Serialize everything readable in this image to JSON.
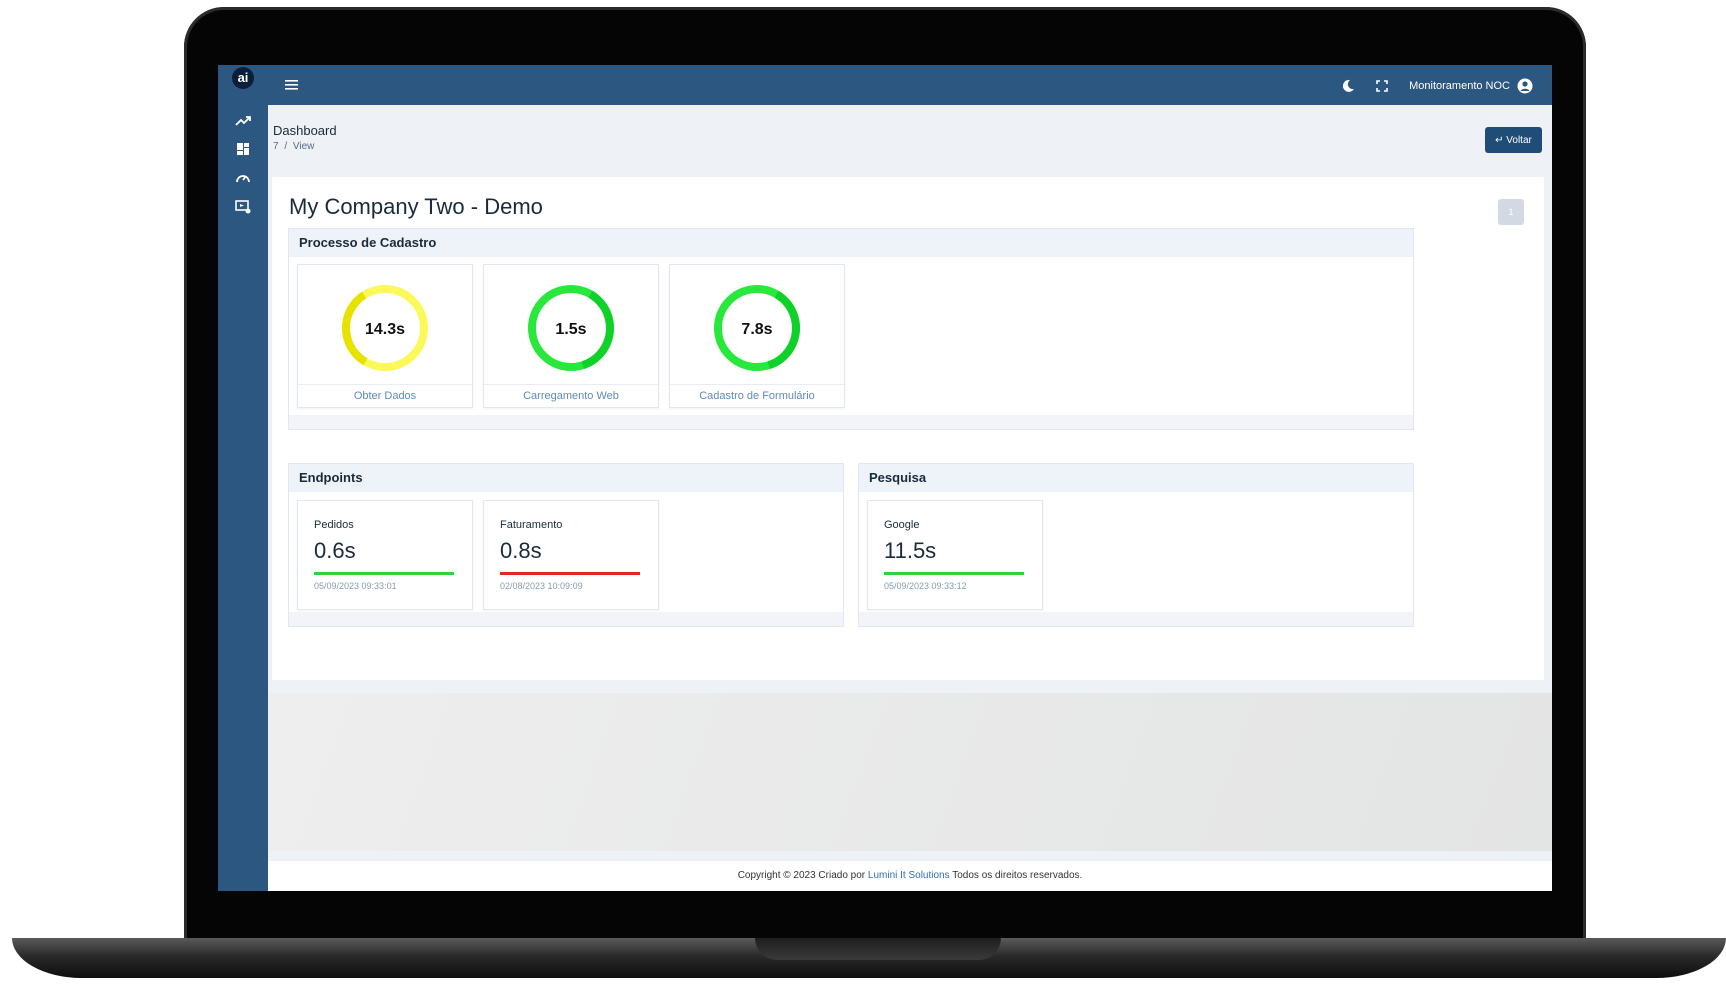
{
  "app": {
    "logo_text": "ai",
    "user_label": "Monitoramento NOC"
  },
  "page": {
    "title": "Dashboard",
    "crumb_id": "7",
    "crumb_sep": "/",
    "crumb_current": "View",
    "back_button": "↵ Voltar"
  },
  "dashboard": {
    "company_title": "My Company Two - Demo",
    "page_number": "1"
  },
  "processo": {
    "title": "Processo de Cadastro",
    "gauges": [
      {
        "value": "14.3s",
        "label": "Obter Dados",
        "status": "warning",
        "color": "#f4f02c"
      },
      {
        "value": "1.5s",
        "label": "Carregamento Web",
        "status": "ok",
        "color": "#13e22f"
      },
      {
        "value": "7.8s",
        "label": "Cadastro de Formulário",
        "status": "ok",
        "color": "#13e22f"
      }
    ]
  },
  "endpoints": {
    "title": "Endpoints",
    "items": [
      {
        "name": "Pedidos",
        "value": "0.6s",
        "date": "05/09/2023 09:33:01",
        "status_color": "#2ed33a"
      },
      {
        "name": "Faturamento",
        "value": "0.8s",
        "date": "02/08/2023 10:09:09",
        "status_color": "#e52424"
      }
    ]
  },
  "pesquisa": {
    "title": "Pesquisa",
    "items": [
      {
        "name": "Google",
        "value": "11.5s",
        "date": "05/09/2023 09:33:12",
        "status_color": "#2ed33a"
      }
    ]
  },
  "footer": {
    "prefix": "Copyright © 2023 Criado por",
    "link": "Lumini It Solutions",
    "suffix": "Todos os direitos reservados."
  },
  "icons": {
    "sidebar": [
      "trending-icon",
      "dashboard-grid-icon",
      "speedometer-icon",
      "video-settings-icon"
    ],
    "topbar": [
      "menu-icon",
      "moon-icon",
      "fullscreen-icon",
      "user-circle-icon"
    ]
  },
  "colors": {
    "primary": "#2b5780",
    "button": "#1f4d77",
    "ok": "#13e22f",
    "warning": "#f4f02c",
    "error": "#e52424"
  }
}
